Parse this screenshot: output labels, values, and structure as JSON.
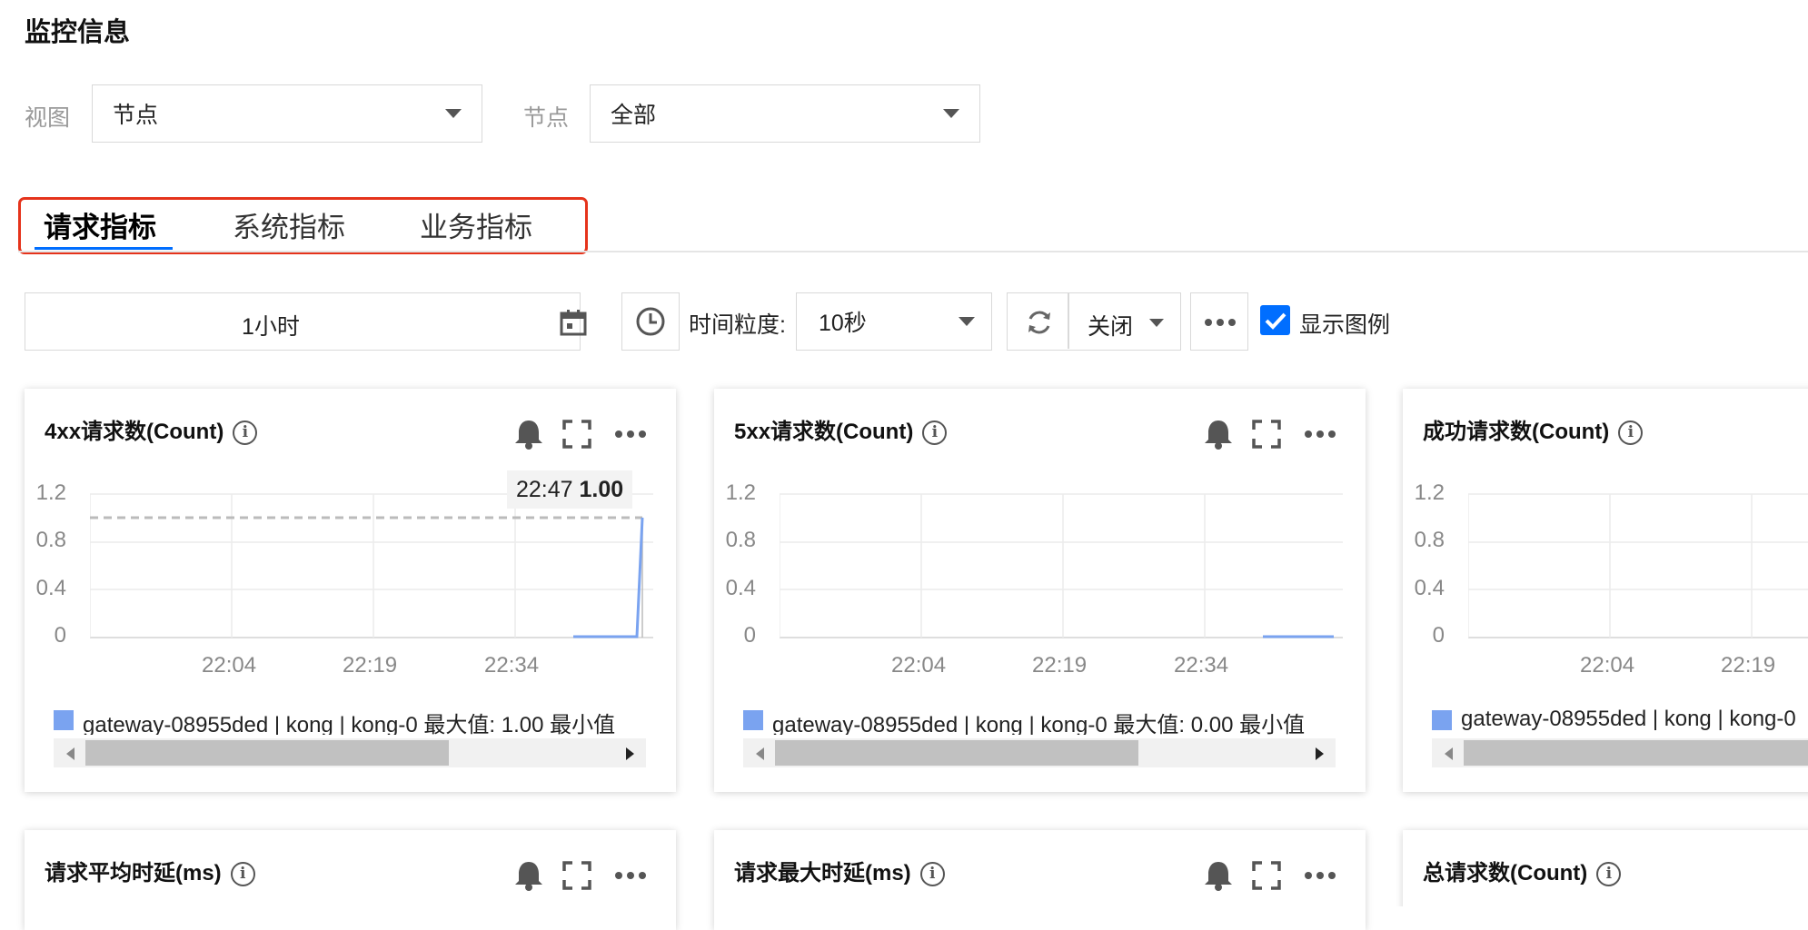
{
  "header": {
    "title": "监控信息"
  },
  "filters": {
    "view_label": "视图",
    "view_value": "节点",
    "node_label": "节点",
    "node_value": "全部"
  },
  "tabs": [
    {
      "label": "请求指标",
      "active": true
    },
    {
      "label": "系统指标",
      "active": false
    },
    {
      "label": "业务指标",
      "active": false
    }
  ],
  "toolbar": {
    "time_range": "1小时",
    "granularity_label": "时间粒度:",
    "granularity_value": "10秒",
    "refresh_value": "关闭",
    "show_legend_label": "显示图例",
    "show_legend_checked": true
  },
  "colors": {
    "accent": "#006eff",
    "series": "#7aa3f0",
    "highlight_border": "#e5331b"
  },
  "cards_row1": [
    {
      "title": "4xx请求数(Count)",
      "tooltip_time": "22:47",
      "tooltip_value": "1.00",
      "legend": "gateway-08955ded | kong | kong-0  最大值: 1.00  最小值"
    },
    {
      "title": "5xx请求数(Count)",
      "legend": "gateway-08955ded | kong | kong-0  最大值: 0.00  最小值"
    },
    {
      "title": "成功请求数(Count)",
      "legend": "gateway-08955ded | kong | kong-0"
    }
  ],
  "cards_row2": [
    {
      "title": "请求平均时延(ms)"
    },
    {
      "title": "请求最大时延(ms)"
    },
    {
      "title": "总请求数(Count)"
    }
  ],
  "chart_data": [
    {
      "type": "line",
      "title": "4xx请求数(Count)",
      "y_ticks": [
        "1.2",
        "0.8",
        "0.4",
        "0"
      ],
      "x_ticks": [
        "22:04",
        "22:19",
        "22:34"
      ],
      "ylim": [
        0,
        1.2
      ],
      "series": [
        {
          "name": "gateway-08955ded | kong | kong-0",
          "points": [
            [
              "22:44",
              0
            ],
            [
              "22:46",
              0
            ],
            [
              "22:47",
              1
            ]
          ]
        }
      ]
    },
    {
      "type": "line",
      "title": "5xx请求数(Count)",
      "y_ticks": [
        "1.2",
        "0.8",
        "0.4",
        "0"
      ],
      "x_ticks": [
        "22:04",
        "22:19",
        "22:34"
      ],
      "ylim": [
        0,
        1.2
      ],
      "series": [
        {
          "name": "gateway-08955ded | kong | kong-0",
          "points": [
            [
              "22:41",
              0
            ],
            [
              "22:47",
              0
            ]
          ]
        }
      ]
    },
    {
      "type": "line",
      "title": "成功请求数(Count)",
      "y_ticks": [
        "1.2",
        "0.8",
        "0.4",
        "0"
      ],
      "x_ticks": [
        "22:04",
        "22:19"
      ],
      "ylim": [
        0,
        1.2
      ],
      "series": [
        {
          "name": "gateway-08955ded | kong | kong-0",
          "points": []
        }
      ]
    }
  ]
}
